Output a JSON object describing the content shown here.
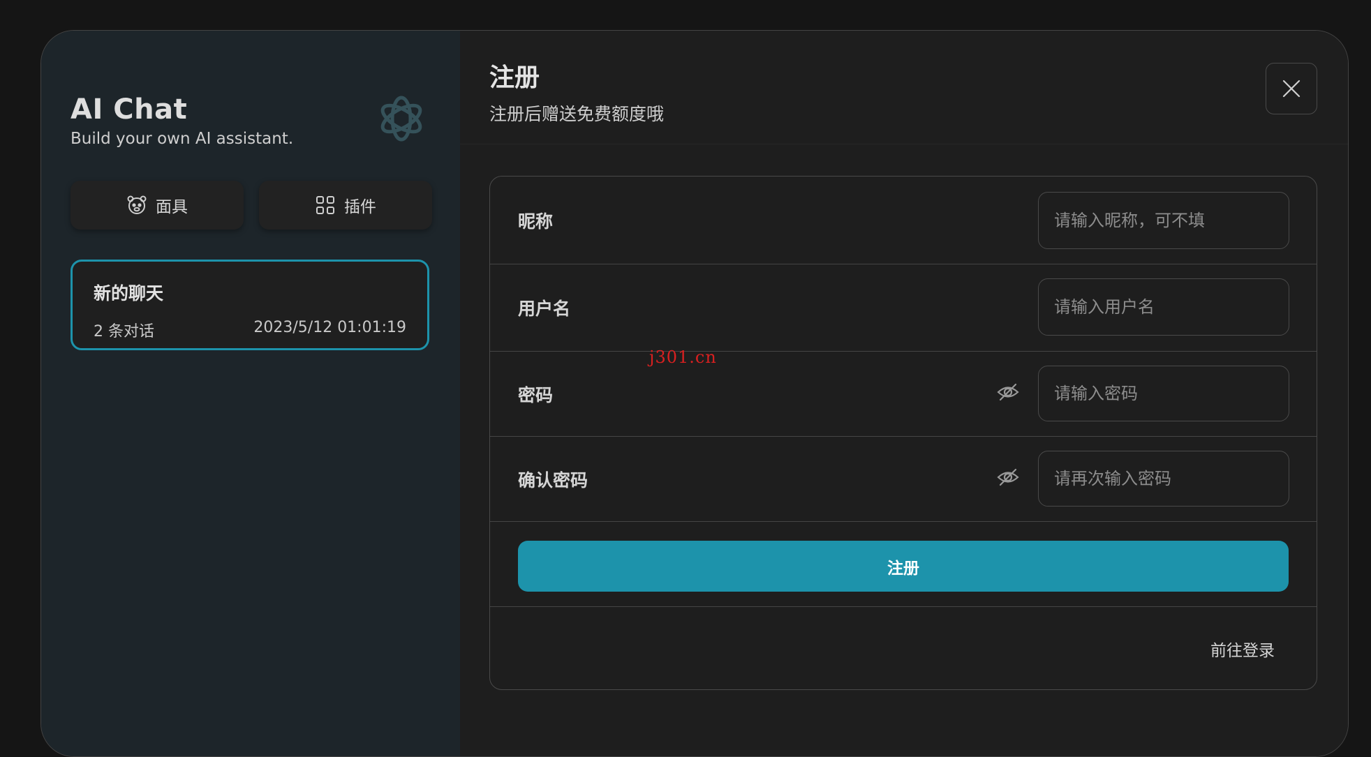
{
  "sidebar": {
    "app_title": "AI Chat",
    "app_subtitle": "Build your own AI assistant.",
    "logo_icon": "openai-logo-icon",
    "buttons": [
      {
        "label": "面具",
        "icon": "mask-icon"
      },
      {
        "label": "插件",
        "icon": "plugin-grid-icon"
      }
    ],
    "chats": [
      {
        "title": "新的聊天",
        "count": "2 条对话",
        "time": "2023/5/12 01:01:19"
      }
    ]
  },
  "header": {
    "title": "注册",
    "subtitle": "注册后赠送免费额度哦",
    "close_icon": "close-icon"
  },
  "form": {
    "nickname": {
      "label": "昵称",
      "placeholder": "请输入昵称，可不填"
    },
    "username": {
      "label": "用户名",
      "placeholder": "请输入用户名"
    },
    "password": {
      "label": "密码",
      "placeholder": "请输入密码",
      "icon": "eye-off-icon"
    },
    "confirm": {
      "label": "确认密码",
      "placeholder": "请再次输入密码",
      "icon": "eye-off-icon"
    },
    "submit_label": "注册",
    "login_link": "前往登录"
  },
  "watermark": "j301.cn",
  "colors": {
    "accent": "#1d93ab",
    "background": "#151515",
    "sidebar": "#1d252a",
    "panel": "#1e1e1e"
  }
}
